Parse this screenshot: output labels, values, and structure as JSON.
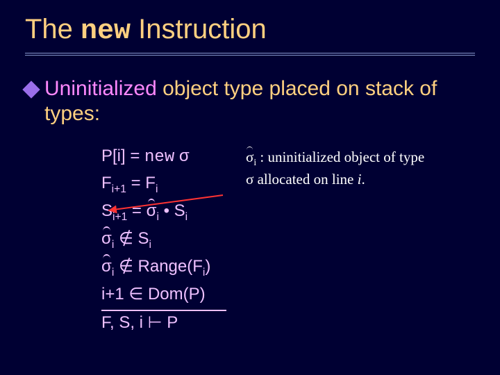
{
  "title": {
    "pre": "The ",
    "keyword": "new",
    "post": " Instruction"
  },
  "bullet": {
    "keyword": "Uninitialized",
    "rest": " object type placed on stack of types:"
  },
  "rules": {
    "l1_a": "P[i] = ",
    "l1_kw": "new",
    "l1_b": " σ",
    "l2": "F",
    "l2_s1": "i+1",
    "l2_m": " = F",
    "l2_s2": "i",
    "l3_a": "S",
    "l3_s1": "i+1",
    "l3_m": " = ",
    "l3_hat": "σ",
    "l3_hsub": "i",
    "l3_b": " • S",
    "l3_s2": "i",
    "l4_hat": "σ",
    "l4_hsub": "i",
    "l4_m": " ∉ S",
    "l4_s": "i",
    "l5_hat": "σ",
    "l5_hsub": "i",
    "l5_m": " ∉ Range(F",
    "l5_s": "i",
    "l5_b": ")",
    "l6": "i+1 ∈ Dom(P)",
    "l7": "F, S, i  ⊢   P"
  },
  "note": {
    "hat": "σ",
    "hsub": "i",
    "rest1": " : uninitialized object of type σ allocated on line ",
    "ivar": "i",
    "dot": "."
  },
  "colors": {
    "bg": "#000033",
    "title": "#ffd080",
    "body": "#eec0ff",
    "keyword": "#ff88ff",
    "bullet_icon": "#9a6eea",
    "arrow": "#ff3333"
  }
}
